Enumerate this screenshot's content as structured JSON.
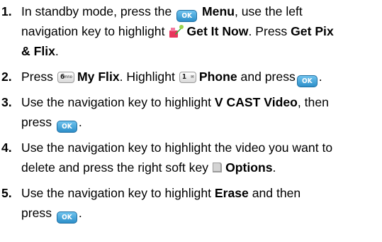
{
  "steps": [
    {
      "number": "1.",
      "line1_a": "In standby mode, press the",
      "line1_menu": "Menu",
      "line1_b": ", use the left",
      "line2_a": "navigation key to highlight",
      "line2_getitnow": "Get It Now",
      "line2_b": ". Press",
      "line2_getpix": "Get Pix",
      "line3_flix": "& Flix",
      "line3_end": "."
    },
    {
      "number": "2.",
      "press": "Press",
      "myflix": "My Flix",
      "highlight": ". Highlight",
      "phone": "Phone",
      "andpress": "and press",
      "end": "."
    },
    {
      "number": "3.",
      "line1_a": "Use the navigation key to highlight",
      "line1_vcast": "V CAST Video",
      "line1_b": ", then",
      "line2_press": "press",
      "line2_end": "."
    },
    {
      "number": "4.",
      "line1": "Use the navigation key to highlight the video you want to",
      "line2_a": "delete and press the right soft key",
      "line2_options": "Options",
      "line2_end": "."
    },
    {
      "number": "5.",
      "line1_a": "Use the navigation key to highlight",
      "line1_erase": "Erase",
      "line1_b": "and then",
      "line2_press": "press",
      "line2_end": "."
    }
  ],
  "icons": {
    "ok_label": "OK",
    "key6_digit": "6",
    "key6_letters": "mno",
    "key1_digit": "1",
    "ok_color": "#3fa4db",
    "getitnow_colors": [
      "#e8365d",
      "#2fae3a"
    ]
  }
}
